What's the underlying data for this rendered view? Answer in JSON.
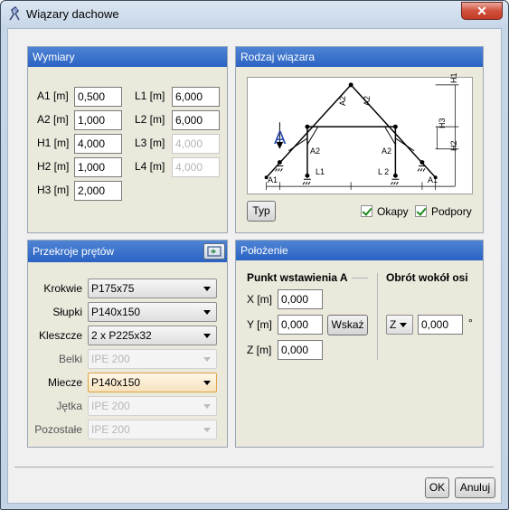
{
  "window": {
    "title": "Wiązary dachowe",
    "close_label": "✕"
  },
  "wymiary": {
    "title": "Wymiary",
    "fields": [
      {
        "label": "A1 [m]",
        "value": "0,500",
        "enabled": true
      },
      {
        "label": "A2 [m]",
        "value": "1,000",
        "enabled": true
      },
      {
        "label": "H1 [m]",
        "value": "4,000",
        "enabled": true
      },
      {
        "label": "H2 [m]",
        "value": "1,000",
        "enabled": true
      },
      {
        "label": "H3 [m]",
        "value": "2,000",
        "enabled": true
      },
      {
        "label": "L1 [m]",
        "value": "6,000",
        "enabled": true
      },
      {
        "label": "L2 [m]",
        "value": "6,000",
        "enabled": true
      },
      {
        "label": "L3 [m]",
        "value": "4,000",
        "enabled": false
      },
      {
        "label": "L4 [m]",
        "value": "4,000",
        "enabled": false
      }
    ]
  },
  "rodzaj": {
    "title": "Rodzaj wiązara",
    "type_button": "Typ",
    "okapy_label": "Okapy",
    "okapy_checked": true,
    "podpory_label": "Podpory",
    "podpory_checked": true,
    "diagram": {
      "point_label": "A",
      "labels": [
        "H1",
        "H3",
        "H2",
        "A2",
        "A2",
        "A2",
        "A2",
        "A1",
        "L1",
        "L 2",
        "A1"
      ]
    }
  },
  "przekroje": {
    "title": "Przekroje prętów",
    "rows": [
      {
        "label": "Krokwie",
        "value": "P175x75",
        "enabled": true
      },
      {
        "label": "Słupki",
        "value": "P140x150",
        "enabled": true
      },
      {
        "label": "Kleszcze",
        "value": "2 x P225x32",
        "enabled": true
      },
      {
        "label": "Belki",
        "value": "IPE 200",
        "enabled": false
      },
      {
        "label": "Miecze",
        "value": "P140x150",
        "enabled": true
      },
      {
        "label": "Jętka",
        "value": "IPE 200",
        "enabled": false
      },
      {
        "label": "Pozostałe",
        "value": "IPE 200",
        "enabled": false
      }
    ]
  },
  "polozenie": {
    "title": "Położenie",
    "insert_title": "Punkt wstawienia A",
    "rotation_title": "Obrót wokół osi",
    "x_label": "X [m]",
    "x_value": "0,000",
    "y_label": "Y [m]",
    "y_value": "0,000",
    "z_label": "Z [m]",
    "z_value": "0,000",
    "pick_button": "Wskaż",
    "axis_value": "Z",
    "angle_value": "0,000",
    "angle_unit": "°"
  },
  "footer": {
    "ok": "OK",
    "cancel": "Anuluj"
  },
  "colors": {
    "panel_header": "#2f68c6",
    "accent_red": "#c23b25",
    "check": "#1a8a1a",
    "highlight_border": "#e0a446"
  }
}
